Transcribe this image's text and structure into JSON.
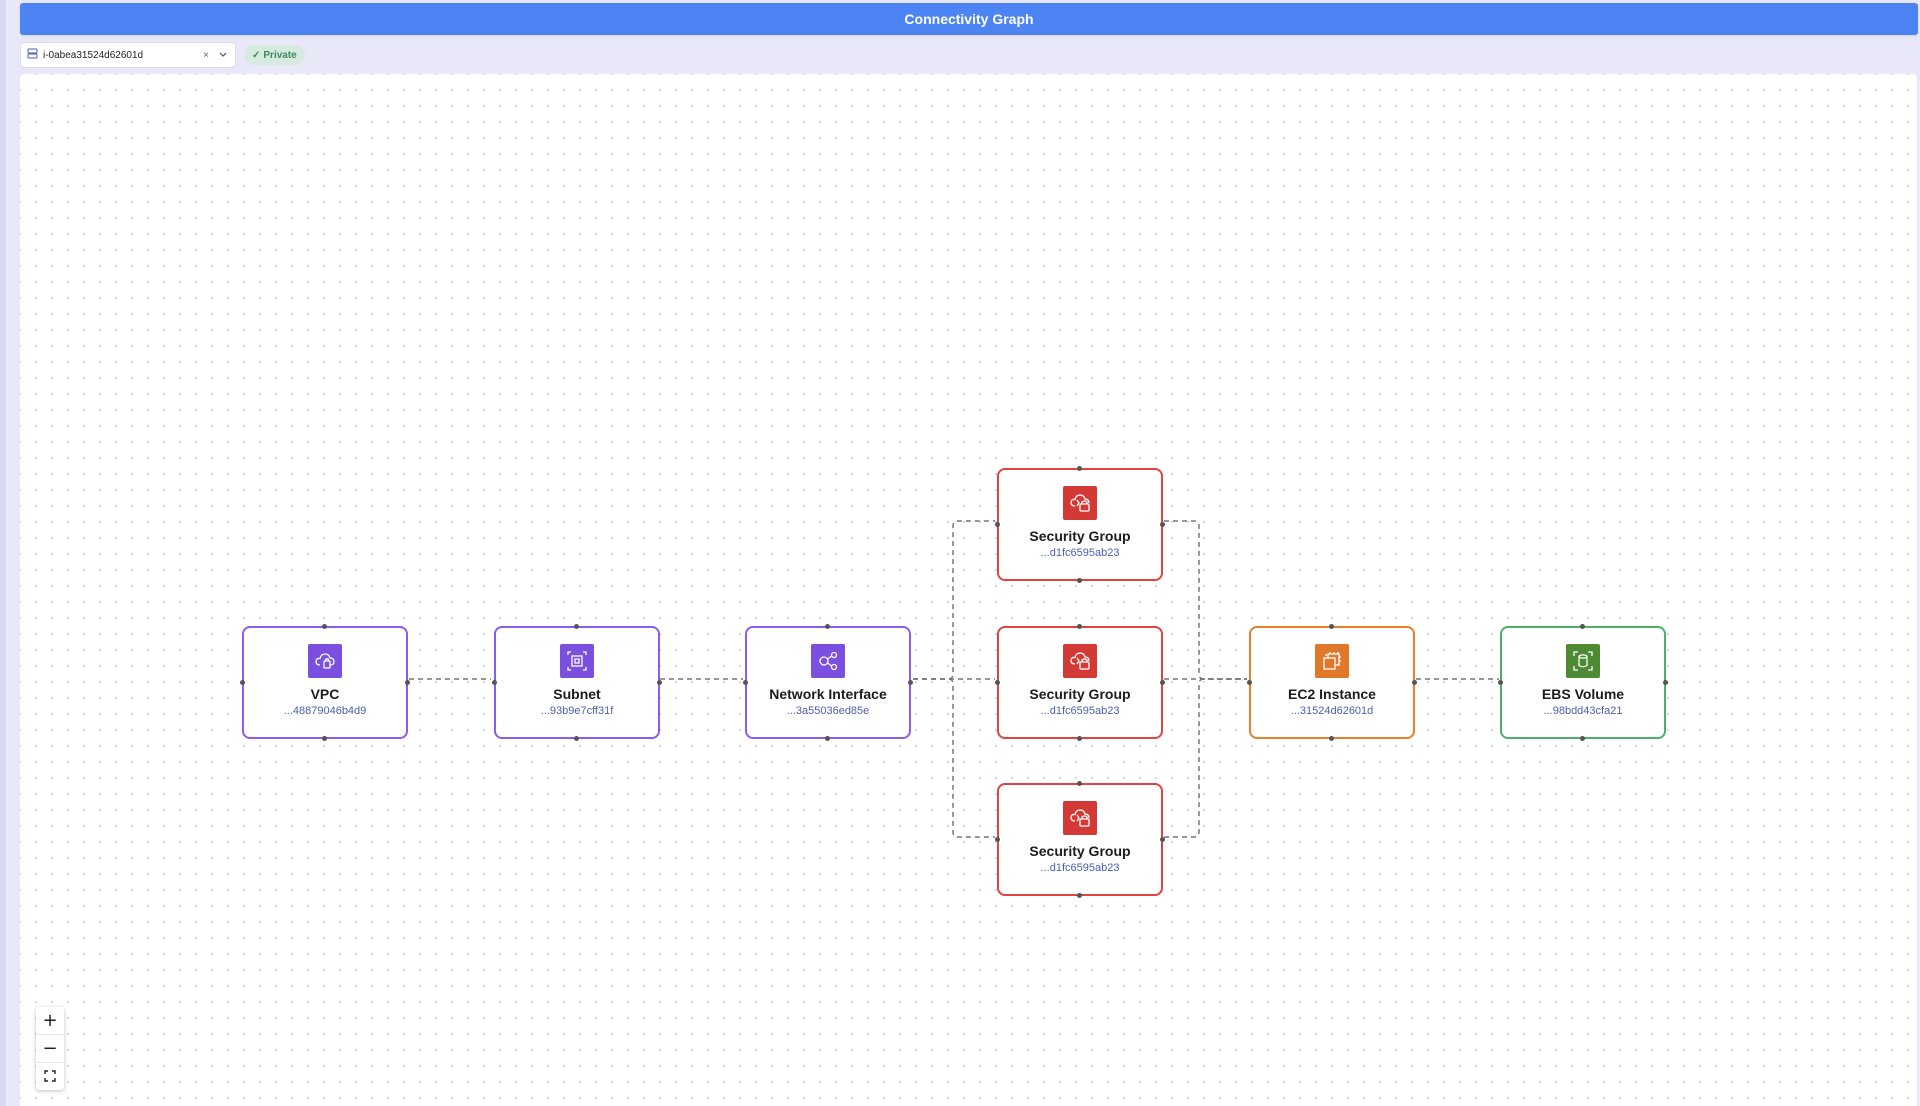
{
  "header": {
    "title": "Connectivity Graph"
  },
  "toolbar": {
    "selected_resource": "i-0abea31524d62601d",
    "clear_symbol": "×",
    "dropdown_icon": "chevron-down-icon",
    "badge_label": "Private",
    "badge_check": "✓"
  },
  "colors": {
    "header": "#4d84f3",
    "network": "#8a5cf0",
    "security": "#e0443f",
    "compute": "#e97e2c",
    "storage": "#4caf6a"
  },
  "nodes": {
    "vpc": {
      "title": "VPC",
      "id": "...48879046b4d9",
      "icon": "vpc-icon"
    },
    "subnet": {
      "title": "Subnet",
      "id": "...93b9e7cff31f",
      "icon": "subnet-icon"
    },
    "eni": {
      "title": "Network Interface",
      "id": "...3a55036ed85e",
      "icon": "network-interface-icon"
    },
    "sg1": {
      "title": "Security Group",
      "id": "...d1fc6595ab23",
      "icon": "security-group-icon"
    },
    "sg2": {
      "title": "Security Group",
      "id": "...d1fc6595ab23",
      "icon": "security-group-icon"
    },
    "sg3": {
      "title": "Security Group",
      "id": "...d1fc6595ab23",
      "icon": "security-group-icon"
    },
    "ec2": {
      "title": "EC2 Instance",
      "id": "...31524d62601d",
      "icon": "ec2-instance-icon"
    },
    "ebs": {
      "title": "EBS Volume",
      "id": "...98bdd43cfa21",
      "icon": "ebs-volume-icon"
    }
  },
  "zoom": {
    "in": "+",
    "out": "−",
    "fit": "fit-view-icon"
  }
}
